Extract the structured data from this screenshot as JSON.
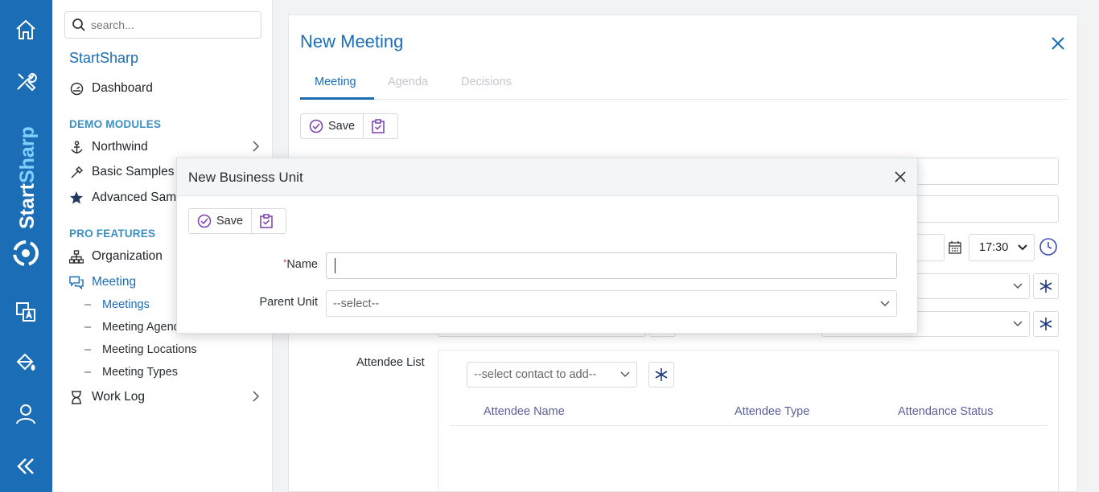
{
  "rail": {
    "icons": [
      "home-icon",
      "tools-icon",
      "translate-icon",
      "paint-bucket-icon",
      "user-icon",
      "collapse-icon"
    ],
    "brand_text": "StartSharp"
  },
  "sidebar": {
    "search_placeholder": "search...",
    "title": "StartSharp",
    "dashboard": "Dashboard",
    "section_demo": "DEMO MODULES",
    "northwind": "Northwind",
    "basic_samples": "Basic Samples",
    "advanced_samples": "Advanced Samples",
    "section_pro": "PRO FEATURES",
    "organization": "Organization",
    "meeting": "Meeting",
    "sub_meetings": "Meetings",
    "sub_agenda": "Meeting Agenda Types",
    "sub_locations": "Meeting Locations",
    "sub_types": "Meeting Types",
    "work_log": "Work Log"
  },
  "main": {
    "title": "New Meeting",
    "tabs": [
      {
        "label": "Meeting",
        "selected": true
      },
      {
        "label": "Agenda",
        "selected": false
      },
      {
        "label": "Decisions",
        "selected": false
      }
    ],
    "save_label": "Save",
    "end_time": "17:30",
    "attendee_label": "Attendee List",
    "contact_placeholder": "--select contact to add--",
    "attendee_columns": [
      "Attendee Name",
      "Attendee Type",
      "Attendance Status"
    ]
  },
  "modal": {
    "title": "New Business Unit",
    "save_label": "Save",
    "name_label": "Name",
    "required_mark": "*",
    "name_value": "",
    "parent_label": "Parent Unit",
    "parent_placeholder": "--select--"
  },
  "colors": {
    "brand": "#1b6db5",
    "section": "#3c8fc2",
    "accent_purple": "#7a3fb0",
    "required": "#d9342b"
  }
}
